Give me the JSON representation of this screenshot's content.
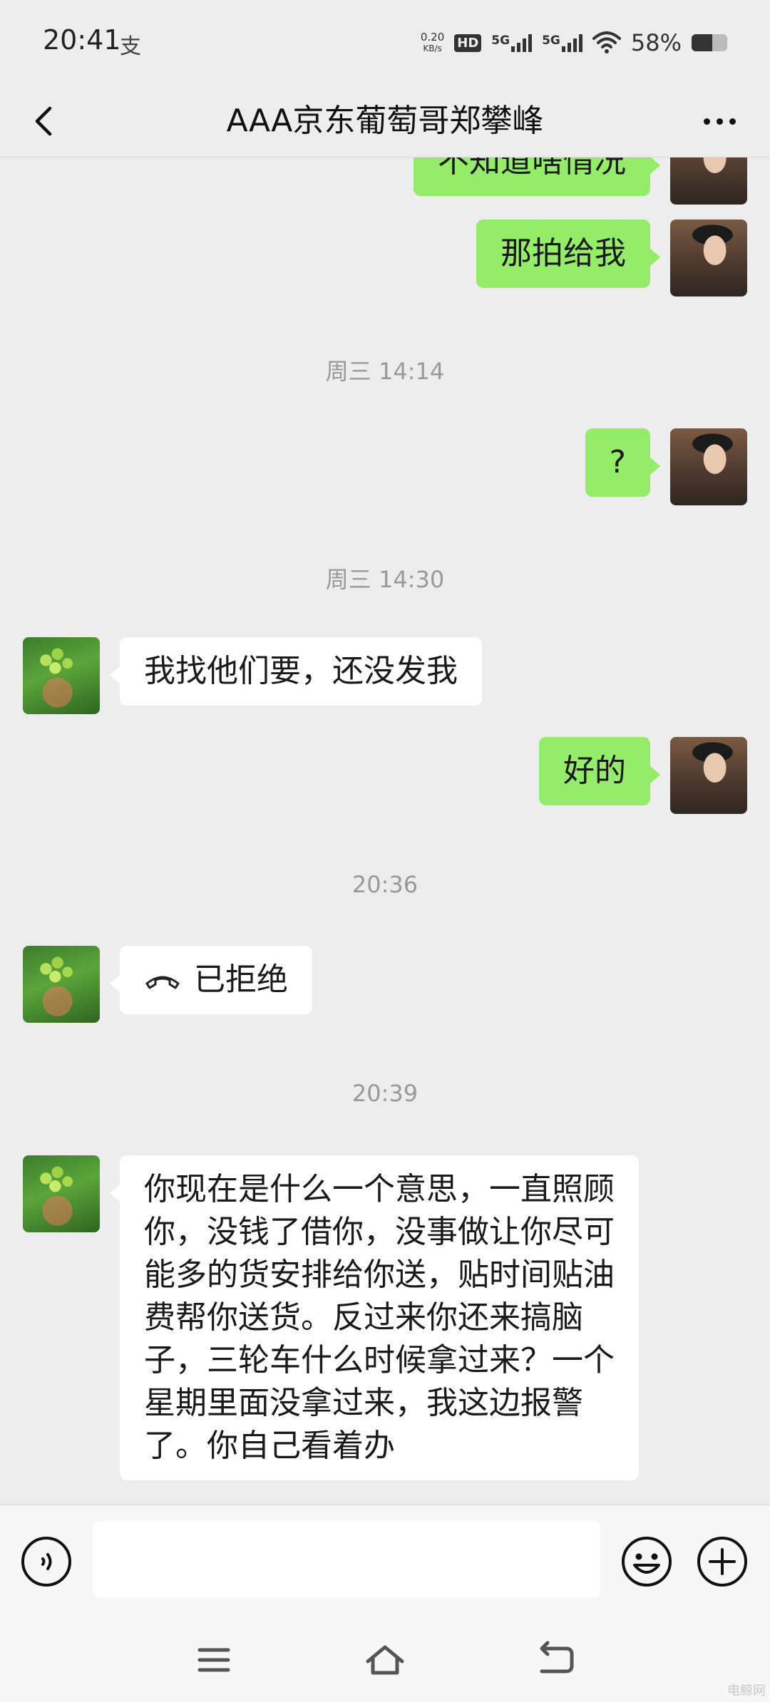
{
  "status_bar": {
    "time": "20:41",
    "extra_glyph": "支",
    "net_speed_value": "0.20",
    "net_speed_unit": "KB/s",
    "hd_label": "HD",
    "sim1_label": "5G",
    "sim2_label": "5G",
    "battery_text": "58%",
    "battery_level": 0.58
  },
  "header": {
    "title": "AAA京东葡萄哥郑攀峰"
  },
  "messages": [
    {
      "type": "sent",
      "text": "不知道啥情况"
    },
    {
      "type": "sent",
      "text": "那拍给我"
    },
    {
      "type": "time",
      "text": "周三 14:14"
    },
    {
      "type": "sent",
      "text": "?"
    },
    {
      "type": "time",
      "text": "周三 14:30"
    },
    {
      "type": "recv",
      "text": "我找他们要，还没发我"
    },
    {
      "type": "sent",
      "text": "好的"
    },
    {
      "type": "time",
      "text": "20:36"
    },
    {
      "type": "recv_call",
      "text": "已拒绝",
      "icon": "phone-hangup-icon"
    },
    {
      "type": "time",
      "text": "20:39"
    },
    {
      "type": "recv",
      "text": "你现在是什么一个意思，一直照顾\n你，没钱了借你，没事做让你尽可\n能多的货安排给你送，贴时间贴油\n费帮你送货。反过来你还来搞脑\n子，三轮车什么时候拿过来？一个\n星期里面没拿过来，我这边报警\n了。你自己看着办"
    }
  ],
  "input_bar": {
    "value": "",
    "voice_icon": "voice-icon",
    "emoji_icon": "emoji-icon",
    "plus_icon": "plus-icon"
  },
  "system_nav": {
    "menu_icon": "menu-icon",
    "home_icon": "home-icon",
    "back_icon": "back-icon"
  },
  "watermark": "电鲸网",
  "colors": {
    "sent_bubble": "#95ec69",
    "recv_bubble": "#ffffff",
    "background": "#ededed"
  }
}
